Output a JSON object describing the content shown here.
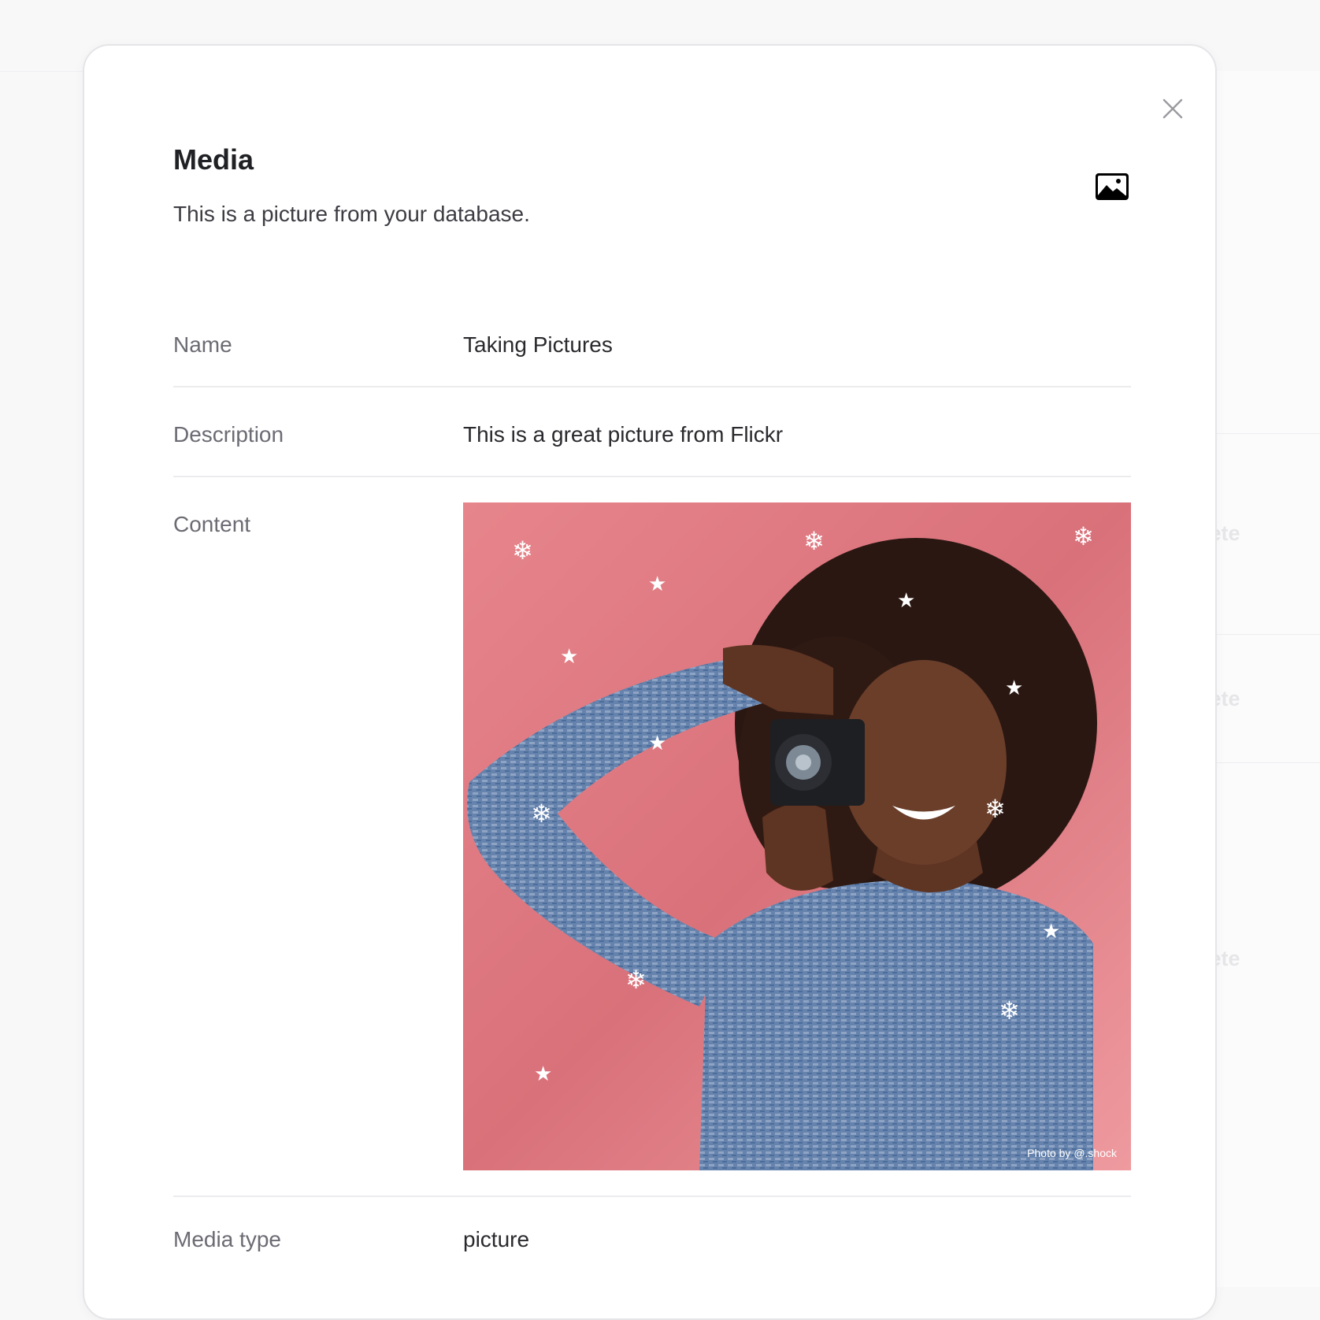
{
  "modal": {
    "title": "Media",
    "subtitle": "This is a picture from your database.",
    "close_icon": "close-icon",
    "type_icon": "image-icon"
  },
  "fields": {
    "name": {
      "label": "Name",
      "value": "Taking Pictures"
    },
    "description": {
      "label": "Description",
      "value": "This is a great picture from Flickr"
    },
    "content": {
      "label": "Content",
      "photo_credit": "Photo by @.shock"
    },
    "media_type": {
      "label": "Media type",
      "value": "picture"
    }
  },
  "background": {
    "delete_labels": [
      "lete",
      "lete",
      "lete"
    ]
  },
  "colors": {
    "photo_background": "#e8828a",
    "sweater": "#5f7ea8",
    "skin": "#6b3e2a",
    "hair": "#2a1712"
  }
}
